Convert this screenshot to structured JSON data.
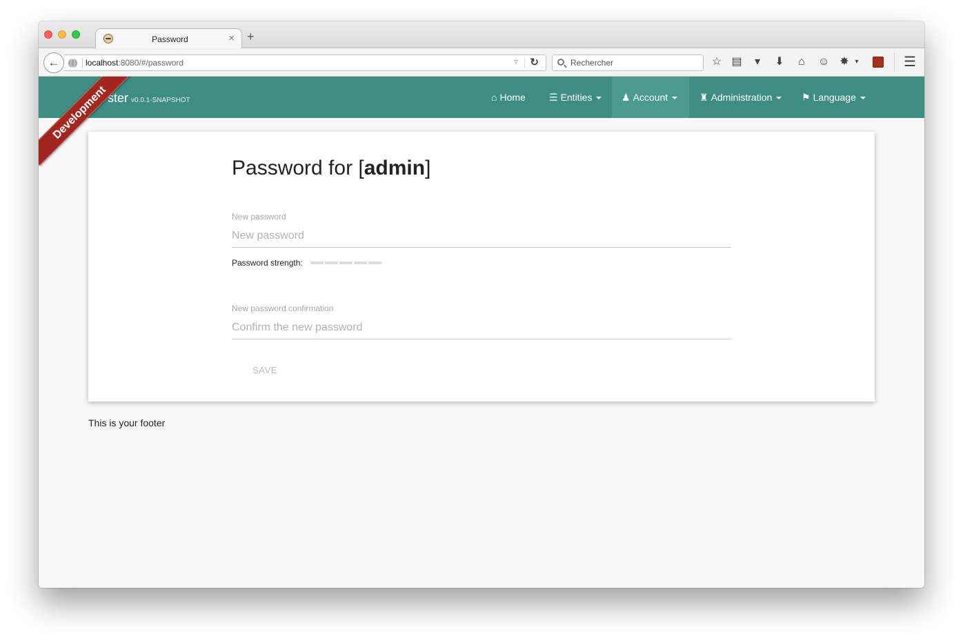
{
  "browser": {
    "tab_title": "Password",
    "new_tab_symbol": "+",
    "close_symbol": "×",
    "url_host": "localhost",
    "url_rest": ":8080/#/password",
    "search_placeholder": "Rechercher"
  },
  "app": {
    "brand_partial": "ster",
    "version": "v0.0.1-SNAPSHOT",
    "ribbon": "Development",
    "nav": {
      "home": "Home",
      "entities": "Entities",
      "account": "Account",
      "administration": "Administration",
      "language": "Language"
    }
  },
  "form": {
    "title_prefix": "Password for [",
    "user": "admin",
    "title_suffix": "]",
    "new_password_label": "New password",
    "new_password_placeholder": "New password",
    "strength_label": "Password strength:",
    "confirm_label": "New password confirmation",
    "confirm_placeholder": "Confirm the new password",
    "save_label": "SAVE"
  },
  "footer": {
    "text": "This is your footer"
  },
  "colors": {
    "navbar": "#3e8d83",
    "navbar_active": "#4b9a90",
    "ribbon": "#a3271f"
  },
  "icons": {
    "back": "arrow-left-icon",
    "reload": "reload-icon",
    "home": "home-icon",
    "entities": "list-icon",
    "account": "user-icon",
    "administration": "tower-icon",
    "language": "flag-icon"
  }
}
